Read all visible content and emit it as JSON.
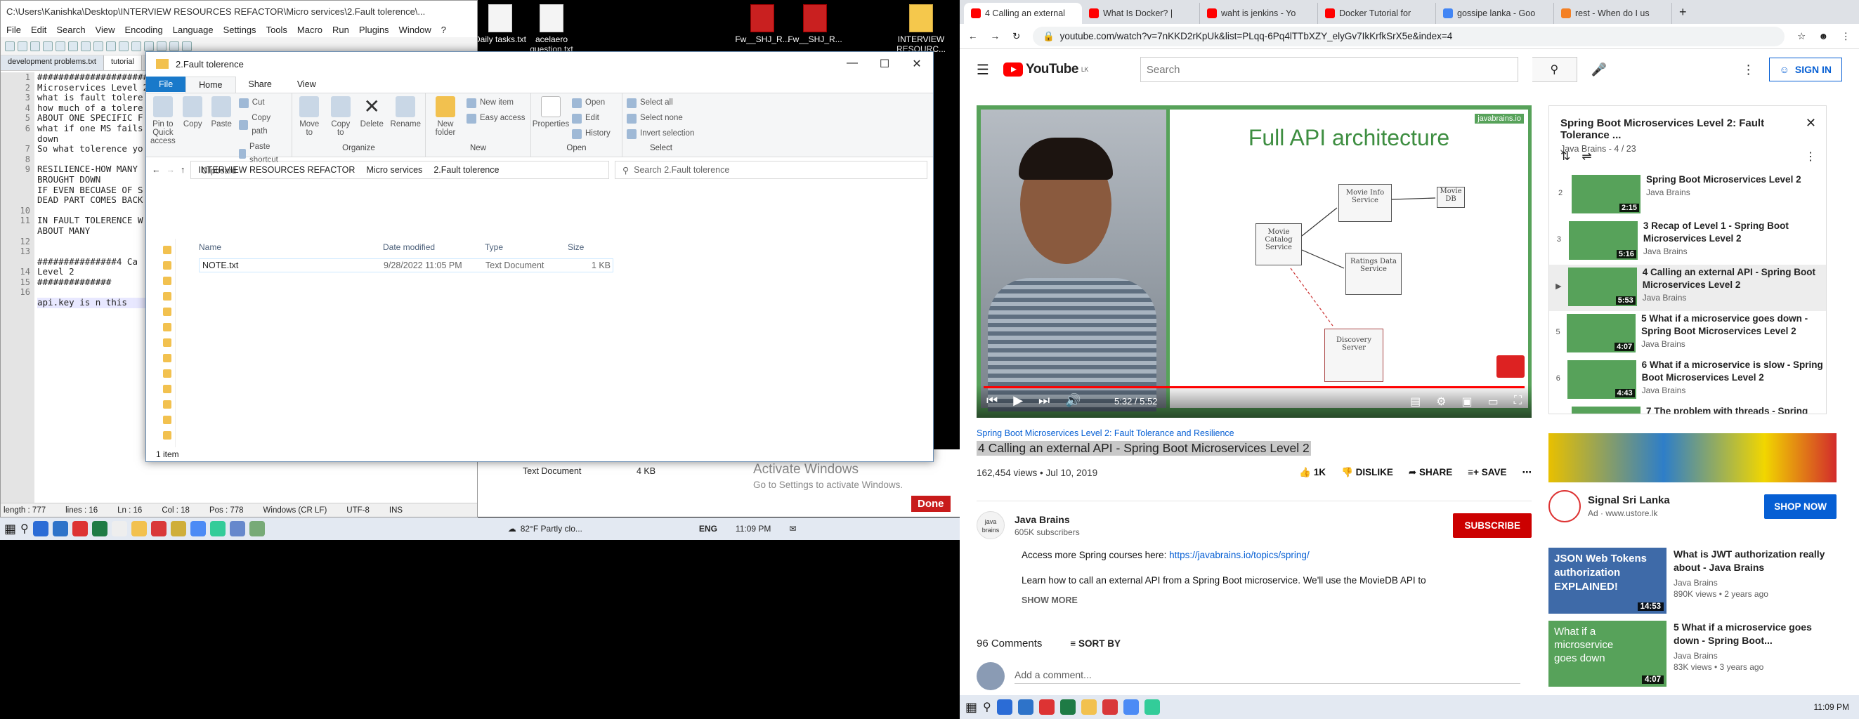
{
  "left": {
    "notepad": {
      "title": "C:\\Users\\Kanishka\\Desktop\\INTERVIEW RESOURCES REFACTOR\\Micro services\\2.Fault tolerence\\...",
      "menu": [
        "File",
        "Edit",
        "Search",
        "View",
        "Encoding",
        "Language",
        "Settings",
        "Tools",
        "Macro",
        "Run",
        "Plugins",
        "Window",
        "?"
      ],
      "tabs": [
        "development problems.txt",
        "tutorial"
      ],
      "lines": [
        "##############################",
        "Microservices Level 2",
        "what is fault tolere",
        "how much of a tolere",
        "ABOUT ONE SPECIFIC F",
        "what if one MS fails",
        "down",
        "So what tolerence yo",
        "",
        "RESILIENCE-HOW MANY",
        "BROUGHT DOWN",
        "IF EVEN BECUASE OF S",
        "DEAD PART COMES BACK",
        "",
        "IN FAULT TOLERENCE W",
        "ABOUT MANY",
        "",
        "",
        "###############4 Ca",
        "Level 2",
        "##############",
        "",
        "api.key is n this"
      ],
      "line_numbers": [
        "1",
        "2",
        "3",
        "4",
        "5",
        "6",
        "",
        "7",
        "8",
        "9",
        "",
        "",
        "",
        "10",
        "11",
        "",
        "12",
        "13",
        "",
        "14",
        "15",
        "16"
      ],
      "status": {
        "length": "length : 777",
        "lines": "lines : 16",
        "ln": "Ln : 16",
        "col": "Col : 18",
        "pos": "Pos : 778",
        "eol": "Windows (CR LF)",
        "enc": "UTF-8",
        "ins": "INS"
      }
    },
    "desktop_icons": [
      {
        "label": "Daily tasks.txt"
      },
      {
        "label": "acelaero question.txt"
      },
      {
        "label": "Fw__SHJ_R..."
      },
      {
        "label": "Fw__SHJ_R..."
      },
      {
        "label": "INTERVIEW RESOURC..."
      }
    ],
    "explorer": {
      "title": "2.Fault tolerence",
      "ribbon_tabs": [
        "File",
        "Home",
        "Share",
        "View"
      ],
      "clipboard": {
        "pin": "Pin to Quick access",
        "copy": "Copy",
        "paste": "Paste",
        "cut": "Cut",
        "copy_path": "Copy path",
        "paste_shortcut": "Paste shortcut",
        "caption": "Clipboard"
      },
      "organize": {
        "move": "Move to",
        "copy": "Copy to",
        "delete": "Delete",
        "rename": "Rename",
        "caption": "Organize"
      },
      "new": {
        "folder": "New folder",
        "item": "New item",
        "easy": "Easy access",
        "caption": "New"
      },
      "open": {
        "props": "Properties",
        "open": "Open",
        "edit": "Edit",
        "history": "History",
        "caption": "Open"
      },
      "select": {
        "all": "Select all",
        "none": "Select none",
        "invert": "Invert selection",
        "caption": "Select"
      },
      "path": [
        "INTERVIEW RESOURCES REFACTOR",
        "Micro services",
        "2.Fault tolerence"
      ],
      "search_placeholder": "Search 2.Fault tolerence",
      "columns": [
        "Name",
        "Date modified",
        "Type",
        "Size"
      ],
      "files": [
        {
          "name": "NOTE.txt",
          "date": "9/28/2022 11:05 PM",
          "type": "Text Document",
          "size": "1 KB"
        }
      ],
      "status": "1 item"
    },
    "behind": {
      "type": "Text Document",
      "size": "4 KB",
      "activate": "Activate Windows",
      "activate_sub": "Go to Settings to activate Windows.",
      "done": "Done"
    },
    "taskbar": {
      "weather": "82°F  Partly clo...",
      "lang": "ENG",
      "time": "11:09 PM"
    }
  },
  "right": {
    "tabs": [
      {
        "label": "4 Calling an external",
        "color": "#ff0000"
      },
      {
        "label": "What Is Docker? | ",
        "color": "#ff0000"
      },
      {
        "label": "waht is jenkins - Yo",
        "color": "#ff0000"
      },
      {
        "label": "Docker Tutorial for",
        "color": "#ff0000"
      },
      {
        "label": "gossipe lanka - Goo",
        "color": "#4285f4"
      },
      {
        "label": "rest - When do I us",
        "color": "#f48024"
      }
    ],
    "url": "youtube.com/watch?v=7nKKD2rKpUk&list=PLqq-6Pq4lTTbXZY_elyGv7IkKrfkSrX5e&index=4",
    "yt": {
      "country": "LK",
      "search_placeholder": "Search",
      "signin": "SIGN IN",
      "slide_title": "Full API architecture",
      "slide_brand": "javabrains.io",
      "diagram": [
        "Movie Catalog Service",
        "Movie Info Service",
        "Movie DB",
        "Ratings Data Service",
        "Discovery Server"
      ],
      "time": "5:32 / 5:52",
      "playlist_link": "Spring Boot Microservices Level 2: Fault Tolerance and Resilience",
      "video_title": "4 Calling an external API - Spring Boot Microservices Level 2",
      "views": "162,454 views • Jul 10, 2019",
      "likes": "1K",
      "dislike": "DISLIKE",
      "share": "SHARE",
      "save": "SAVE",
      "channel": "Java Brains",
      "subs": "605K subscribers",
      "subscribe": "SUBSCRIBE",
      "desc1": "Access more Spring courses here: ",
      "desc_link": "https://javabrains.io/topics/spring/",
      "desc2": "Learn how to call an external API from a Spring Boot microservice. We'll use the MovieDB API to",
      "show_more": "SHOW MORE",
      "comments": "96 Comments",
      "sort": "SORT BY",
      "add_comment": "Add a comment..."
    },
    "playlist": {
      "title": "Spring Boot Microservices Level 2: Fault Tolerance ...",
      "sub": "Java Brains - 4 / 23",
      "items": [
        {
          "num": "2",
          "title": "Spring Boot Microservices Level 2",
          "ch": "Java Brains",
          "dur": "2:15"
        },
        {
          "num": "3",
          "title": "3 Recap of Level 1 - Spring Boot Microservices Level 2",
          "ch": "Java Brains",
          "dur": "5:16"
        },
        {
          "num": "▶",
          "title": "4 Calling an external API - Spring Boot Microservices Level 2",
          "ch": "Java Brains",
          "dur": "5:53"
        },
        {
          "num": "5",
          "title": "5 What if a microservice goes down - Spring Boot Microservices Level 2",
          "ch": "Java Brains",
          "dur": "4:07"
        },
        {
          "num": "6",
          "title": "6 What if a microservice is slow - Spring Boot Microservices Level 2",
          "ch": "Java Brains",
          "dur": "4:43"
        },
        {
          "num": "",
          "title": "7 The problem with threads - Spring",
          "ch": "",
          "dur": ""
        }
      ]
    },
    "ad": {
      "title": "Signal Sri Lanka",
      "sub": "Ad · www.ustore.lk",
      "cta": "SHOP NOW"
    },
    "recs": [
      {
        "title": "What is JWT authorization really about - Java Brains",
        "ch": "Java Brains",
        "meta": "890K views • 2 years ago",
        "dur": "14:53",
        "thumb": "JSON Web Tokens authorization EXPLAINED!"
      },
      {
        "title": "5 What if a microservice goes down - Spring Boot...",
        "ch": "Java Brains",
        "meta": "83K views • 3 years ago",
        "dur": "4:07",
        "thumb": "What if a microservice goes down"
      }
    ],
    "taskbar": {
      "time": "11:09 PM"
    }
  }
}
